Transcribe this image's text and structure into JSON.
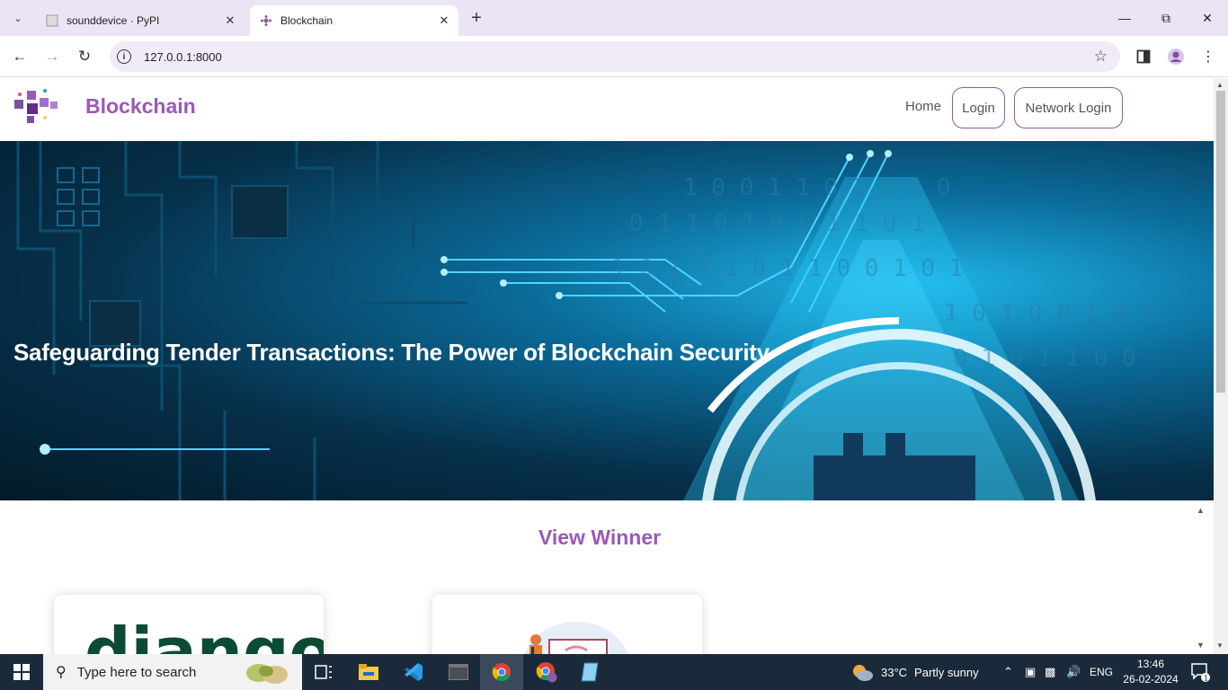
{
  "browser": {
    "tabs": [
      {
        "title": "sounddevice · PyPI"
      },
      {
        "title": "Blockchain"
      }
    ],
    "url": "127.0.0.1:8000"
  },
  "site": {
    "brand": "Blockchain",
    "nav": {
      "home": "Home",
      "login": "Login",
      "network_login": "Network Login"
    },
    "hero_title": "Safeguarding Tender Transactions: The Power of Blockchain Security",
    "section_title": "View Winner",
    "cards": [
      {
        "logo_text": "django"
      },
      {
        "illustration": "person-presenting-illustration"
      }
    ]
  },
  "taskbar": {
    "search_placeholder": "Type here to search",
    "weather_temp": "33°C",
    "weather_text": "Partly sunny",
    "lang": "ENG",
    "time": "13:46",
    "date": "26-02-2024",
    "notification_count": "1"
  },
  "colors": {
    "accent": "#9b59b6",
    "tabbar": "#ece4f5",
    "taskbar": "#1b2a3a"
  }
}
